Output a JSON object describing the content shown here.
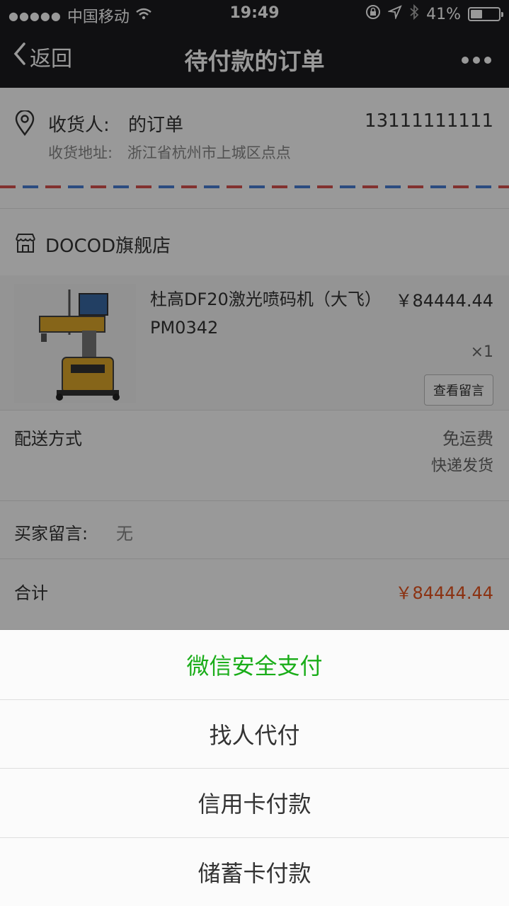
{
  "status_bar": {
    "signal": "●●●●●",
    "carrier": "中国移动",
    "time": "19:49",
    "battery": "41%",
    "battery_level": 0.41
  },
  "nav": {
    "back_label": "返回",
    "title": "待付款的订单"
  },
  "address": {
    "recipient_label": "收货人:",
    "recipient": "的订单",
    "phone": "13111111111",
    "address_label": "收货地址:",
    "address": "浙江省杭州市上城区点点"
  },
  "shop": {
    "name": "DOCOD旗舰店"
  },
  "item": {
    "title": "杜高DF20激光喷码机（大飞）PM0342",
    "price": "￥84444.44",
    "quantity": "×1",
    "view_message_label": "查看留言"
  },
  "delivery": {
    "label": "配送方式",
    "fee": "免运费",
    "method": "快递发货"
  },
  "buyer_message": {
    "label": "买家留言:",
    "value": "无"
  },
  "total": {
    "label": "合计",
    "amount": "￥84444.44"
  },
  "payment_sheet": {
    "options": [
      {
        "label": "微信安全支付"
      },
      {
        "label": "找人代付"
      },
      {
        "label": "信用卡付款"
      },
      {
        "label": "储蓄卡付款"
      }
    ]
  },
  "colors": {
    "accent_green": "#1aad19",
    "price_orange": "#e8541e",
    "nav_bg": "#1c1c1f"
  }
}
